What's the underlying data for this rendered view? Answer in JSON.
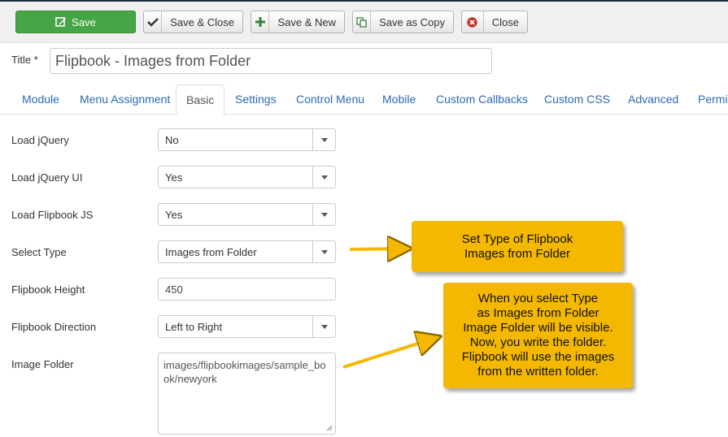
{
  "toolbar": {
    "save_label": "Save",
    "save_close_label": "Save & Close",
    "save_new_label": "Save & New",
    "save_copy_label": "Save as Copy",
    "close_label": "Close"
  },
  "title": {
    "label": "Title *",
    "value": "Flipbook - Images from Folder"
  },
  "tabs": [
    {
      "label": "Module"
    },
    {
      "label": "Menu Assignment"
    },
    {
      "label": "Basic",
      "active": true
    },
    {
      "label": "Settings"
    },
    {
      "label": "Control Menu"
    },
    {
      "label": "Mobile"
    },
    {
      "label": "Custom Callbacks"
    },
    {
      "label": "Custom CSS"
    },
    {
      "label": "Advanced"
    },
    {
      "label": "Permis"
    }
  ],
  "fields": {
    "load_jquery": {
      "label": "Load jQuery",
      "value": "No"
    },
    "load_jquery_ui": {
      "label": "Load jQuery UI",
      "value": "Yes"
    },
    "load_flipbook_js": {
      "label": "Load Flipbook JS",
      "value": "Yes"
    },
    "select_type": {
      "label": "Select Type",
      "value": "Images from Folder"
    },
    "flipbook_height": {
      "label": "Flipbook Height",
      "value": "450"
    },
    "flipbook_direction": {
      "label": "Flipbook Direction",
      "value": "Left to Right"
    },
    "image_folder": {
      "label": "Image Folder",
      "value": "images/flipbookimages/sample_book/newyork"
    }
  },
  "callouts": {
    "type": {
      "lines": [
        "Set Type of Flipbook",
        "Images from Folder"
      ]
    },
    "folder": {
      "lines": [
        "When you select Type",
        "as Images from Folder",
        "Image Folder will be visible.",
        "Now, you write the folder.",
        "Flipbook will use the images",
        "from the written folder."
      ]
    }
  },
  "colors": {
    "save_button": "#46a546",
    "link": "#2a69b8",
    "callout": "#f5b800",
    "close_icon": "#bd362f"
  }
}
